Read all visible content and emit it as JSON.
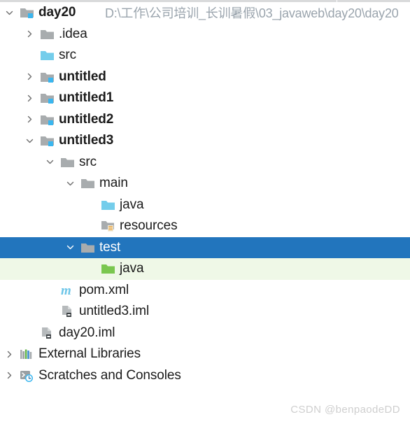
{
  "window": {
    "title": "Project tool window",
    "watermark": "CSDN @benpaodeDD"
  },
  "project_path": "D:\\工作\\公司培训_长训暑假\\03_javaweb\\day20\\day20",
  "colors": {
    "selection_blue": "#2275bd",
    "test_source_green_bg": "#eff8e7",
    "source_folder_blue": "#6ecff5",
    "test_source_folder_green": "#7ac74f",
    "module_folder_gray": "#a8acae",
    "path_text_gray": "#9aa4ad",
    "label_text": "#1b1b1b",
    "watermark_gray": "#cfcfcf"
  },
  "tree": [
    {
      "id": "day20",
      "label": "day20",
      "indent": 0,
      "bold": true,
      "arrow": "expanded",
      "icon": "module-folder-icon",
      "selected": false,
      "highlight": "none",
      "secondary": "D:\\工作\\公司培训_长训暑假\\03_javaweb\\day20\\day20"
    },
    {
      "id": "idea",
      "label": ".idea",
      "indent": 1,
      "bold": false,
      "arrow": "collapsed",
      "icon": "folder-gray-icon",
      "selected": false,
      "highlight": "none",
      "secondary": ""
    },
    {
      "id": "src-day20",
      "label": "src",
      "indent": 1,
      "bold": false,
      "arrow": "none",
      "icon": "folder-source-blue-icon",
      "selected": false,
      "highlight": "none",
      "secondary": ""
    },
    {
      "id": "untitled",
      "label": "untitled",
      "indent": 1,
      "bold": true,
      "arrow": "collapsed",
      "icon": "module-folder-icon",
      "selected": false,
      "highlight": "none",
      "secondary": ""
    },
    {
      "id": "untitled1",
      "label": "untitled1",
      "indent": 1,
      "bold": true,
      "arrow": "collapsed",
      "icon": "module-folder-icon",
      "selected": false,
      "highlight": "none",
      "secondary": ""
    },
    {
      "id": "untitled2",
      "label": "untitled2",
      "indent": 1,
      "bold": true,
      "arrow": "collapsed",
      "icon": "module-folder-icon",
      "selected": false,
      "highlight": "none",
      "secondary": ""
    },
    {
      "id": "untitled3",
      "label": "untitled3",
      "indent": 1,
      "bold": true,
      "arrow": "expanded",
      "icon": "module-folder-icon",
      "selected": false,
      "highlight": "none",
      "secondary": ""
    },
    {
      "id": "src-untitled3",
      "label": "src",
      "indent": 2,
      "bold": false,
      "arrow": "expanded",
      "icon": "folder-gray-icon",
      "selected": false,
      "highlight": "none",
      "secondary": ""
    },
    {
      "id": "main",
      "label": "main",
      "indent": 3,
      "bold": false,
      "arrow": "expanded",
      "icon": "folder-gray-icon",
      "selected": false,
      "highlight": "none",
      "secondary": ""
    },
    {
      "id": "main-java",
      "label": "java",
      "indent": 4,
      "bold": false,
      "arrow": "none",
      "icon": "folder-source-blue-icon",
      "selected": false,
      "highlight": "none",
      "secondary": ""
    },
    {
      "id": "resources",
      "label": "resources",
      "indent": 4,
      "bold": false,
      "arrow": "none",
      "icon": "folder-resources-icon",
      "selected": false,
      "highlight": "none",
      "secondary": ""
    },
    {
      "id": "test",
      "label": "test",
      "indent": 3,
      "bold": false,
      "arrow": "expanded",
      "icon": "folder-gray-icon",
      "selected": true,
      "highlight": "selection",
      "secondary": ""
    },
    {
      "id": "test-java",
      "label": "java",
      "indent": 4,
      "bold": false,
      "arrow": "none",
      "icon": "folder-test-source-green-icon",
      "selected": false,
      "highlight": "test-source",
      "secondary": ""
    },
    {
      "id": "pom",
      "label": "pom.xml",
      "indent": 2,
      "bold": false,
      "arrow": "none",
      "icon": "maven-m-icon",
      "selected": false,
      "highlight": "none",
      "secondary": ""
    },
    {
      "id": "untitled3-iml",
      "label": "untitled3.iml",
      "indent": 2,
      "bold": false,
      "arrow": "none",
      "icon": "iml-file-icon",
      "selected": false,
      "highlight": "none",
      "secondary": ""
    },
    {
      "id": "day20-iml",
      "label": "day20.iml",
      "indent": 1,
      "bold": false,
      "arrow": "none",
      "icon": "iml-file-icon",
      "selected": false,
      "highlight": "none",
      "secondary": ""
    },
    {
      "id": "external-libraries",
      "label": "External Libraries",
      "indent": 0,
      "bold": false,
      "arrow": "collapsed",
      "icon": "libraries-icon",
      "selected": false,
      "highlight": "none",
      "secondary": ""
    },
    {
      "id": "scratches",
      "label": "Scratches and Consoles",
      "indent": 0,
      "bold": false,
      "arrow": "collapsed",
      "icon": "scratches-icon",
      "selected": false,
      "highlight": "none",
      "secondary": ""
    }
  ]
}
